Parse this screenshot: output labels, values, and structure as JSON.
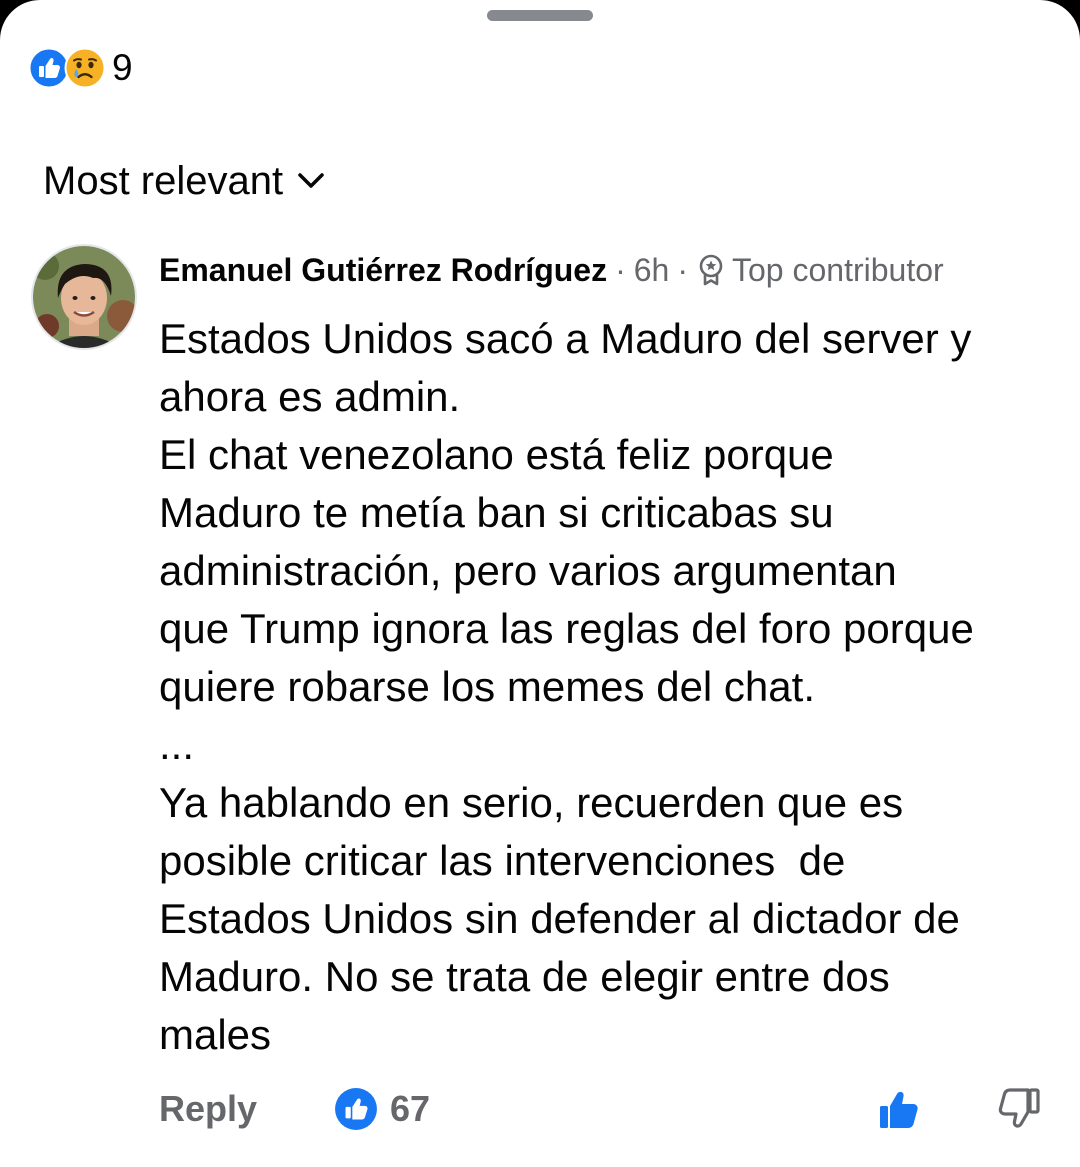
{
  "reactions": {
    "icons": [
      "like-icon",
      "sad-icon"
    ],
    "count": "9"
  },
  "sort": {
    "label": "Most relevant",
    "icon": "chevron-down-icon"
  },
  "comment": {
    "author": "Emanuel Gutiérrez Rodríguez",
    "separator": "·",
    "time": "6h",
    "badge": "Top contributor",
    "lines": [
      "Estados Unidos sacó a Maduro del server y",
      "ahora es admin.",
      "El chat venezolano está feliz porque",
      "Maduro te metía ban si criticabas su",
      "administración, pero varios argumentan",
      "que Trump ignora las reglas del foro porque",
      "quiere robarse los memes del chat.",
      "...",
      "Ya hablando en serio, recuerden que es",
      "posible criticar las intervenciones  de",
      "Estados Unidos sin defender al dictador de",
      "Maduro. No se trata de elegir entre dos",
      "males"
    ]
  },
  "actions": {
    "reply_label": "Reply",
    "like_count": "67"
  },
  "colors": {
    "facebook_blue": "#1877f2",
    "secondary_text": "#65676b",
    "primary_text": "#050505"
  }
}
